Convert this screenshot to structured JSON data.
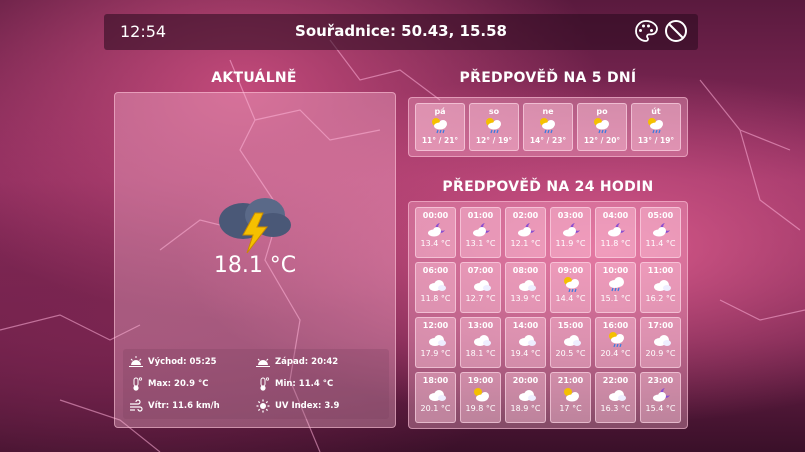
{
  "header": {
    "time": "12:54",
    "coordinates": "Souřadnice: 50.43, 15.58",
    "icons": [
      "palette-icon",
      "block-icon"
    ]
  },
  "current": {
    "title": "AKTUÁLNĚ",
    "icon": "thunderstorm-icon",
    "temperature": "18.1 °C",
    "sunrise": "Východ: 05:25",
    "sunset": "Západ: 20:42",
    "max": "Max: 20.9 °C",
    "min": "Min: 11.4 °C",
    "wind": "Vítr:  11.6 km/h",
    "uv": "UV Index: 3.9"
  },
  "forecast5": {
    "title": "PŘEDPOVĚĎ NA 5 DNÍ",
    "days": [
      {
        "label": "pá",
        "range": "11° / 21°",
        "icon": "sun-cloud-rain-icon"
      },
      {
        "label": "so",
        "range": "12° / 19°",
        "icon": "sun-cloud-rain-icon"
      },
      {
        "label": "ne",
        "range": "14° / 23°",
        "icon": "sun-cloud-rain-icon"
      },
      {
        "label": "po",
        "range": "12° / 20°",
        "icon": "sun-cloud-rain-icon"
      },
      {
        "label": "út",
        "range": "13° / 19°",
        "icon": "sun-cloud-rain-icon"
      }
    ]
  },
  "hourly": {
    "title": "PŘEDPOVĚĎ NA 24 HODIN",
    "hours": [
      {
        "time": "00:00",
        "temp": "13.4 °C",
        "icon": "moon-cloud-icon"
      },
      {
        "time": "01:00",
        "temp": "13.1 °C",
        "icon": "moon-cloud-icon"
      },
      {
        "time": "02:00",
        "temp": "12.1 °C",
        "icon": "moon-cloud-icon"
      },
      {
        "time": "03:00",
        "temp": "11.9 °C",
        "icon": "moon-cloud-icon"
      },
      {
        "time": "04:00",
        "temp": "11.8 °C",
        "icon": "moon-cloud-icon"
      },
      {
        "time": "05:00",
        "temp": "11.4 °C",
        "icon": "moon-cloud-icon"
      },
      {
        "time": "06:00",
        "temp": "11.8 °C",
        "icon": "cloud-icon"
      },
      {
        "time": "07:00",
        "temp": "12.7 °C",
        "icon": "cloud-icon"
      },
      {
        "time": "08:00",
        "temp": "13.9 °C",
        "icon": "cloud-icon"
      },
      {
        "time": "09:00",
        "temp": "14.4 °C",
        "icon": "sun-cloud-rain-icon"
      },
      {
        "time": "10:00",
        "temp": "15.1 °C",
        "icon": "cloud-rain-icon"
      },
      {
        "time": "11:00",
        "temp": "16.2 °C",
        "icon": "cloud-icon"
      },
      {
        "time": "12:00",
        "temp": "17.9 °C",
        "icon": "cloud-icon"
      },
      {
        "time": "13:00",
        "temp": "18.1 °C",
        "icon": "cloud-icon"
      },
      {
        "time": "14:00",
        "temp": "19.4 °C",
        "icon": "cloud-icon"
      },
      {
        "time": "15:00",
        "temp": "20.5 °C",
        "icon": "cloud-icon"
      },
      {
        "time": "16:00",
        "temp": "20.4 °C",
        "icon": "sun-cloud-rain-icon"
      },
      {
        "time": "17:00",
        "temp": "20.9 °C",
        "icon": "cloud-icon"
      },
      {
        "time": "18:00",
        "temp": "20.1 °C",
        "icon": "cloud-icon"
      },
      {
        "time": "19:00",
        "temp": "19.8 °C",
        "icon": "sun-cloud-icon"
      },
      {
        "time": "20:00",
        "temp": "18.9 °C",
        "icon": "cloud-icon"
      },
      {
        "time": "21:00",
        "temp": "17 °C",
        "icon": "sun-cloud-icon"
      },
      {
        "time": "22:00",
        "temp": "16.3 °C",
        "icon": "cloud-icon"
      },
      {
        "time": "23:00",
        "temp": "15.4 °C",
        "icon": "moon-cloud-icon"
      }
    ]
  }
}
